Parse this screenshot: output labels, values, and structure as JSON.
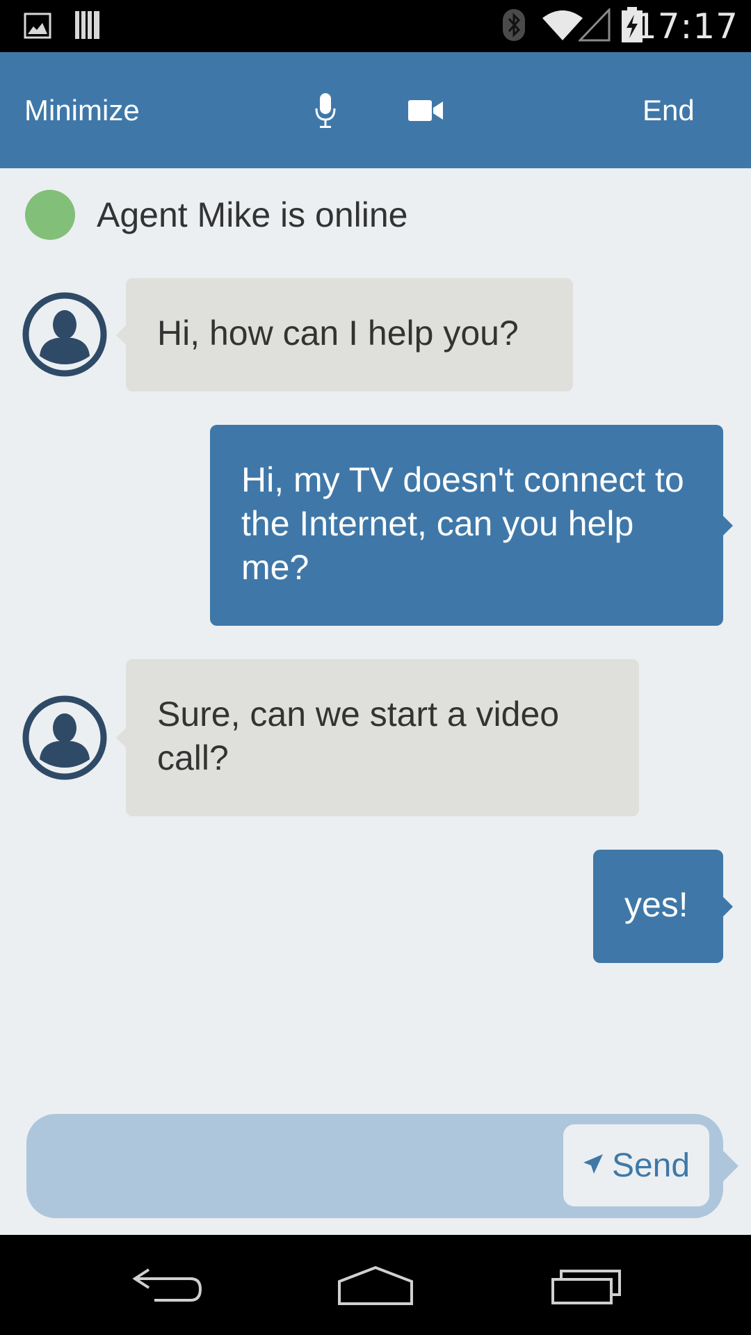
{
  "status_bar": {
    "time": "17:17",
    "icons": [
      "gallery-notification-icon",
      "barcode-notification-icon",
      "bluetooth-icon",
      "wifi-icon",
      "signal-icon",
      "battery-charging-icon"
    ]
  },
  "header": {
    "minimize_label": "Minimize",
    "end_label": "End",
    "icons": [
      "microphone-icon",
      "video-camera-icon"
    ],
    "background": "#3f78a8"
  },
  "presence": {
    "text": "Agent Mike is online",
    "status_color": "#82bf79"
  },
  "messages": [
    {
      "sender": "agent",
      "text": "Hi, how can I help you?"
    },
    {
      "sender": "user",
      "text": "Hi, my TV doesn't connect to the Internet, can you help me?"
    },
    {
      "sender": "agent",
      "text": "Sure, can we start a video call?"
    },
    {
      "sender": "user",
      "text": "yes!"
    }
  ],
  "composer": {
    "value": "",
    "send_label": "Send",
    "send_icon": "paper-plane-icon"
  },
  "nav_bar": {
    "icons": [
      "back-icon",
      "home-icon",
      "recents-icon"
    ]
  },
  "colors": {
    "accent": "#3f78a8",
    "agent_bubble": "#dfdfdb",
    "chat_background": "#ebeff1",
    "composer_background": "#aec6dc",
    "avatar": "#2f4a66"
  }
}
